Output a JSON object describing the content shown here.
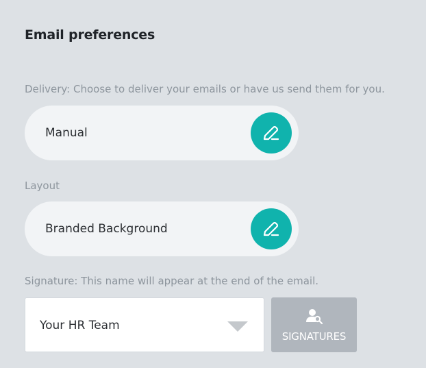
{
  "section": {
    "title": "Email preferences"
  },
  "delivery": {
    "label": "Delivery: Choose to deliver your emails or have us send them for you.",
    "value": "Manual",
    "edit_icon": "pencil-icon"
  },
  "layout": {
    "label": "Layout",
    "value": "Branded Background",
    "edit_icon": "pencil-icon"
  },
  "signature": {
    "label": "Signature: This name will appear at the end of the email.",
    "selected": "Your HR Team",
    "dropdown_icon": "caret-down-icon",
    "button_label": "SIGNATURES",
    "button_icon": "person-search-icon"
  },
  "colors": {
    "background": "#dde1e5",
    "accent": "#10b3ad",
    "pill_bg": "#f2f4f6",
    "button_disabled": "#b0b6bd"
  }
}
